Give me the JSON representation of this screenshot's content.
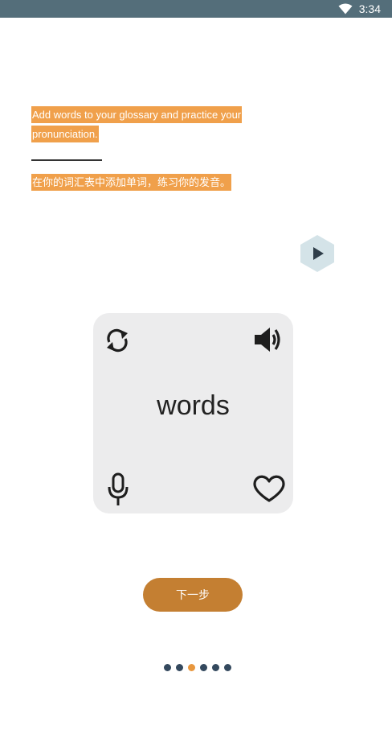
{
  "status_bar": {
    "time": "3:34",
    "icon": "wifi-icon"
  },
  "intro": {
    "text_en": "Add words to your glossary and practice your pronunciation.",
    "text_zh": "在你的词汇表中添加单词，练习你的发音。",
    "highlight_color": "#f0a04b"
  },
  "play_button": {
    "icon": "play-icon",
    "color": "#d4e3e8"
  },
  "card": {
    "word": "words",
    "icons": [
      "refresh-icon",
      "speaker-icon",
      "microphone-icon",
      "heart-icon"
    ]
  },
  "next_button": {
    "label": "下一步",
    "color": "#c47f32"
  },
  "pagination": {
    "total": 6,
    "active_index": 2,
    "active_color": "#e8973e",
    "inactive_color": "#34495e"
  }
}
